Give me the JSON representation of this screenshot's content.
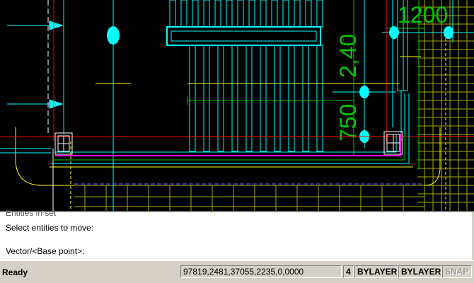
{
  "drawing": {
    "dim_top": "1200",
    "dim_vertical_1": "2,40",
    "dim_vertical_2": "750"
  },
  "command_line": {
    "partial_line": "Entities in set",
    "prompt_line_1": "Select entities to move:",
    "prompt_line_2": "Vector/<Base point>:"
  },
  "status_bar": {
    "state": "Ready",
    "coordinates": "97819,2481,37055,2235,0,0000",
    "color_number": "4",
    "layer": "BYLAYER",
    "linetype": "BYLAYER",
    "snap": "SNAP"
  },
  "colors": {
    "background": "#000000",
    "cyan": "#00ffff",
    "red": "#ff0000",
    "green": "#00c800",
    "yellow": "#ffff00",
    "magenta": "#ff00ff"
  }
}
